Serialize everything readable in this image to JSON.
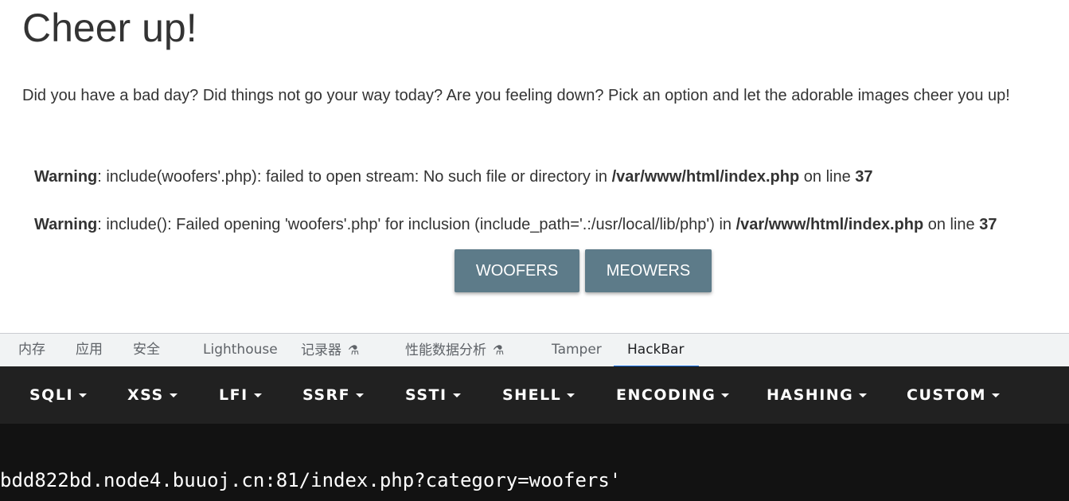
{
  "page": {
    "title": "Cheer up!",
    "intro": "Did you have a bad day? Did things not go your way today? Are you feeling down? Pick an option and let the adorable images cheer you up!",
    "warnings": [
      {
        "label": "Warning",
        "message": ": include(woofers'.php): failed to open stream: No such file or directory in ",
        "path": "/var/www/html/index.php",
        "line_text": " on line ",
        "line": "37"
      },
      {
        "label": "Warning",
        "message": ": include(): Failed opening 'woofers'.php' for inclusion (include_path='.:/usr/local/lib/php') in ",
        "path": "/var/www/html/index.php",
        "line_text": " on line ",
        "line": "37"
      }
    ],
    "buttons": {
      "woofers": "WOOFERS",
      "meowers": "MEOWERS"
    }
  },
  "devtools": {
    "tabs": [
      {
        "label": "内存"
      },
      {
        "label": "应用"
      },
      {
        "label": "安全"
      },
      {
        "label": "Lighthouse"
      },
      {
        "label": "记录器",
        "icon": "flask-icon"
      },
      {
        "label": "性能数据分析",
        "icon": "flask-icon"
      },
      {
        "label": "Tamper"
      },
      {
        "label": "HackBar",
        "active": true
      }
    ]
  },
  "hackbar": {
    "menu": [
      "SQLI",
      "XSS",
      "LFI",
      "SSRF",
      "SSTI",
      "SHELL",
      "ENCODING",
      "HASHING",
      "CUSTOM"
    ],
    "url": "bdd822bd.node4.buuoj.cn:81/index.php?category=woofers'"
  },
  "colors": {
    "button_bg": "#5d7b89",
    "hackbar_menu_bg": "#212121",
    "hackbar_body_bg": "#121212",
    "active_tab_underline": "#1a73e8"
  }
}
